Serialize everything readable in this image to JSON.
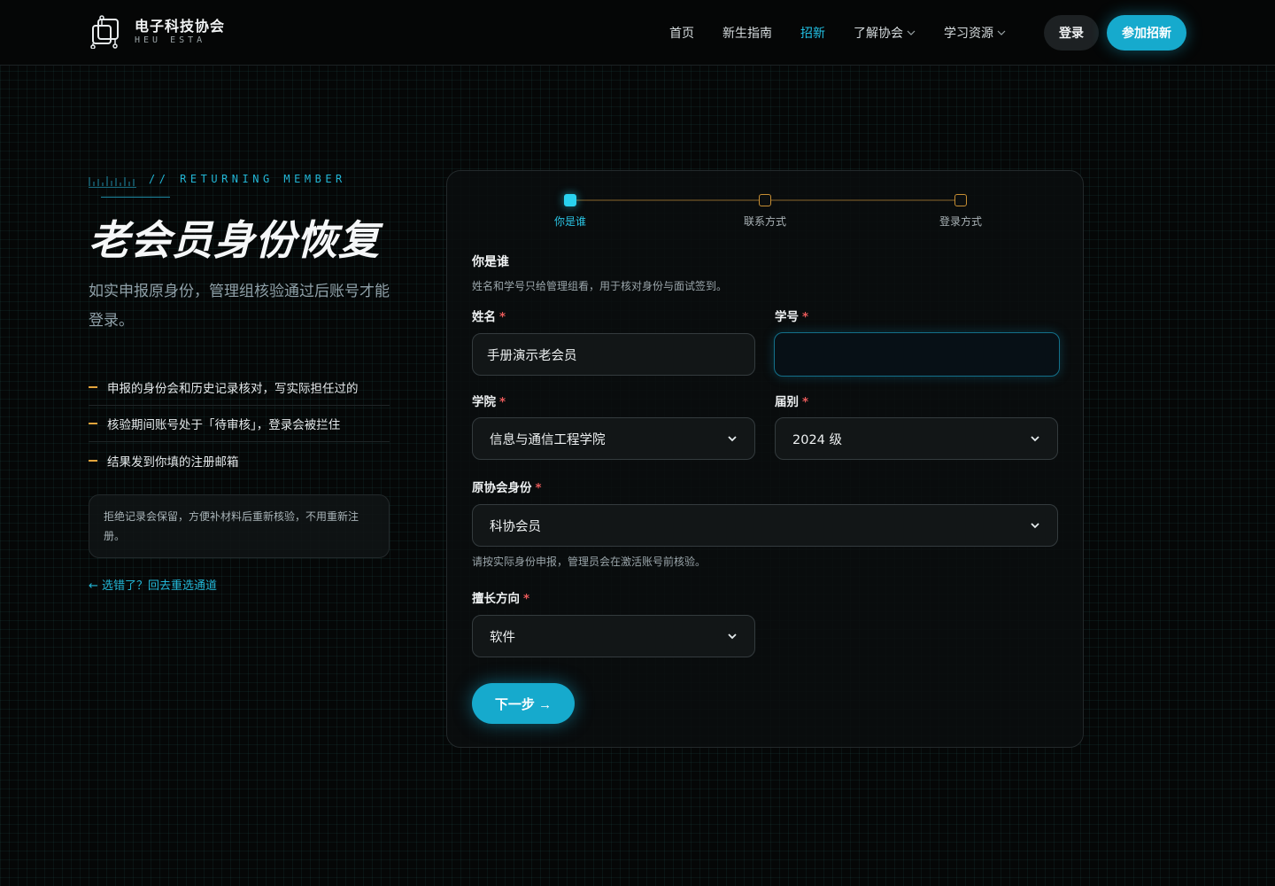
{
  "header": {
    "logo_title": "电子科技协会",
    "logo_sub": "HEU ESTA",
    "nav": [
      {
        "label": "首页",
        "active": false,
        "dropdown": false
      },
      {
        "label": "新生指南",
        "active": false,
        "dropdown": false
      },
      {
        "label": "招新",
        "active": true,
        "dropdown": false
      },
      {
        "label": "了解协会",
        "active": false,
        "dropdown": true
      },
      {
        "label": "学习资源",
        "active": false,
        "dropdown": true
      }
    ],
    "login_label": "登录",
    "join_label": "参加招新"
  },
  "left": {
    "tagline": "// RETURNING MEMBER",
    "title": "老会员身份恢复",
    "subtitle": "如实申报原身份，管理组核验通过后账号才能登录。",
    "bullets": [
      "申报的身份会和历史记录核对，写实际担任过的",
      "核验期间账号处于「待审核」，登录会被拦住",
      "结果发到你填的注册邮箱"
    ],
    "note": "拒绝记录会保留，方便补材料后重新核验，不用重新注册。",
    "back_link": "← 选错了？回去重选通道"
  },
  "form": {
    "steps": [
      {
        "label": "你是谁",
        "active": true
      },
      {
        "label": "联系方式",
        "active": false
      },
      {
        "label": "登录方式",
        "active": false
      }
    ],
    "section_title": "你是谁",
    "section_desc": "姓名和学号只给管理组看，用于核对身份与面试签到。",
    "fields": {
      "name": {
        "label": "姓名",
        "required_mark": "*",
        "value": "手册演示老会员"
      },
      "student_id": {
        "label": "学号",
        "required_mark": "*",
        "value": ""
      },
      "college": {
        "label": "学院",
        "required_mark": "*",
        "value": "信息与通信工程学院"
      },
      "grade": {
        "label": "届别",
        "required_mark": "*",
        "value": "2024 级"
      },
      "role": {
        "label": "原协会身份",
        "required_mark": "*",
        "value": "科协会员",
        "hint": "请按实际身份申报，管理员会在激活账号前核验。"
      },
      "direction": {
        "label": "擅长方向",
        "required_mark": "*",
        "value": "软件"
      }
    },
    "next_label": "下一步 →"
  },
  "colors": {
    "accent": "#16aacd",
    "step_accent": "#c78e33",
    "required": "#e85a5a",
    "background": "#050707"
  }
}
